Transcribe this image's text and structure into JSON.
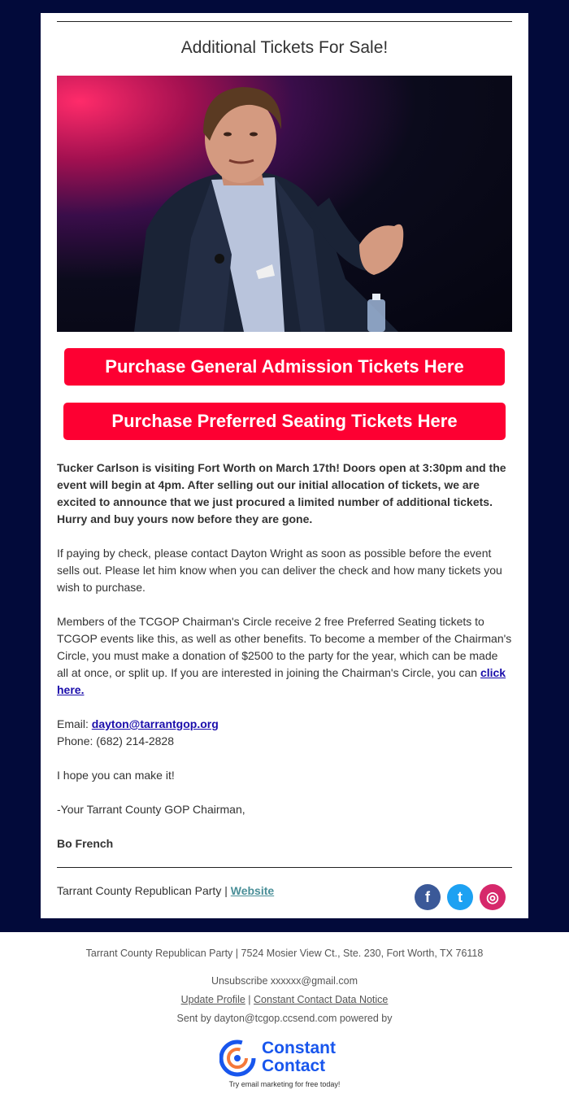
{
  "email": {
    "title": "Additional Tickets For Sale!",
    "buttons": {
      "general": "Purchase General Admission Tickets Here",
      "preferred": "Purchase Preferred Seating Tickets Here"
    },
    "body": {
      "intro": "Tucker Carlson is visiting Fort Worth on March 17th! Doors open at 3:30pm and the event will begin at 4pm. After selling out our initial allocation of tickets, we are excited to announce that we just procured a limited number of additional tickets. Hurry and buy yours now before they are gone.",
      "check": "If paying by check, please contact Dayton Wright as soon as possible before the event sells out. Please let him know when you can deliver the check and how many tickets you wish to purchase.",
      "members": "Members of the TCGOP Chairman's Circle receive 2 free Preferred Seating tickets to TCGOP events like this, as well as other benefits. To become a member of the Chairman's Circle, you must make a donation of $2500 to the party for the year, which can be made all at once, or split up. If you are interested in joining the Chairman's Circle, you can ",
      "members_link": "click here.",
      "email_label": "Email: ",
      "email_value": "dayton@tarrantgop.org",
      "phone": "Phone: (682) 214-2828",
      "hope": "I hope you can make it!",
      "signoff": "-Your Tarrant County GOP Chairman,",
      "signature": "Bo French"
    },
    "footer": {
      "org": "Tarrant County Republican Party | ",
      "website": "Website",
      "social": [
        {
          "name": "facebook-icon",
          "glyph": "f",
          "color": "#3b5998"
        },
        {
          "name": "twitter-icon",
          "glyph": "t",
          "color": "#1da1f2"
        },
        {
          "name": "instagram-icon",
          "glyph": "◎",
          "color": "#d6286b"
        }
      ]
    }
  },
  "bottom": {
    "address": "Tarrant County Republican Party | 7524 Mosier View Ct., Ste. 230, Fort Worth, TX 76118",
    "unsubscribe": "Unsubscribe xxxxxx@gmail.com",
    "update_profile": "Update Profile",
    "separator": " | ",
    "data_notice": "Constant Contact Data Notice",
    "sent_by": "Sent by dayton@tcgop.ccsend.com powered by",
    "logo_line1": "Constant",
    "logo_line2": "Contact",
    "logo_tagline": "Try email marketing for free today!",
    "logo_color": "#1856ed"
  }
}
